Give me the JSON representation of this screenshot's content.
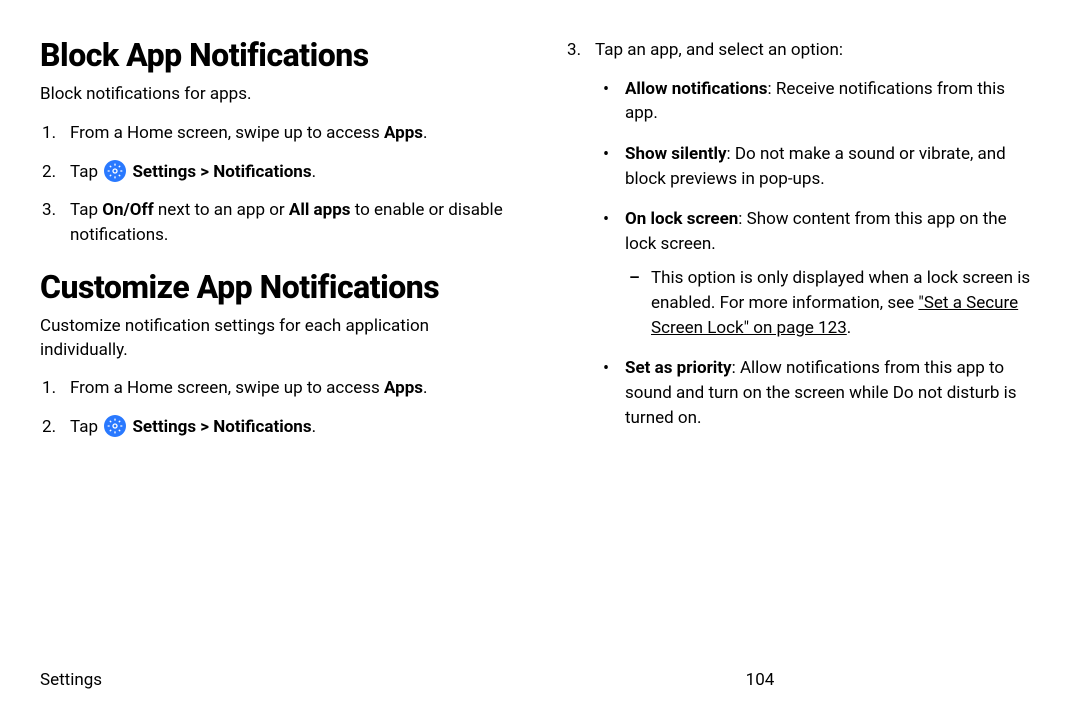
{
  "left": {
    "section1": {
      "heading": "Block App Notifications",
      "intro": "Block notifications for apps.",
      "step1_a": "From a Home screen, swipe up to access ",
      "step1_b": "Apps",
      "step1_c": ".",
      "step2_a": "Tap ",
      "step2_b": "Settings > Notifications",
      "step2_c": ".",
      "step3_a": "Tap ",
      "step3_b": "On/Off",
      "step3_c": " next to an app or ",
      "step3_d": "All apps",
      "step3_e": " to enable or disable notifications."
    },
    "section2": {
      "heading": "Customize App Notifications",
      "intro": "Customize notification settings for each application individually.",
      "step1_a": "From a Home screen, swipe up to access ",
      "step1_b": "Apps",
      "step1_c": ".",
      "step2_a": "Tap ",
      "step2_b": "Settings > Notifications",
      "step2_c": "."
    }
  },
  "right": {
    "step3": "Tap an app, and select an option:",
    "opt1_t": "Allow notifications",
    "opt1_b": ": Receive notifications from this app.",
    "opt2_t": "Show silently",
    "opt2_b": ": Do not make a sound or vibrate, and block previews in pop-ups.",
    "opt3_t": "On lock screen",
    "opt3_b": ": Show content from this app on the lock screen.",
    "opt3_sub_a": "This option is only displayed when a lock screen is enabled. For more information, see ",
    "opt3_sub_link": "\"Set a Secure Screen Lock\" on page 123",
    "opt3_sub_b": ".",
    "opt4_t": "Set as priority",
    "opt4_b": ": Allow notifications from this app to sound and turn on the screen while Do not disturb is turned on."
  },
  "footer": {
    "section": "Settings",
    "page": "104"
  }
}
